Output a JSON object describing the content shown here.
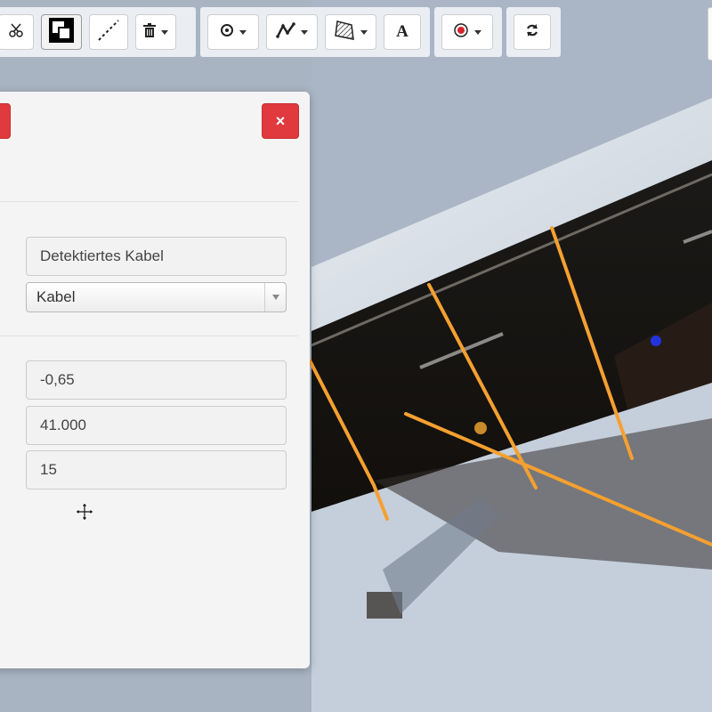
{
  "toolbar": {
    "groups": [
      {
        "name": "edit",
        "buttons": [
          "cut-icon",
          "overlap-squares-icon",
          "dashed-line-icon",
          "trash-icon"
        ]
      },
      {
        "name": "draw",
        "buttons": [
          "point-icon",
          "polyline-icon",
          "polygon-icon",
          "text-icon"
        ]
      },
      {
        "name": "record",
        "buttons": [
          "record-icon"
        ]
      },
      {
        "name": "refresh",
        "buttons": [
          "refresh-icon"
        ]
      }
    ],
    "text_tool_glyph": "A"
  },
  "dialog": {
    "close_label": "×",
    "name_value": "Detektiertes Kabel",
    "type_selected": "Kabel",
    "value_1": "-0,65",
    "value_2": "41.000",
    "value_3": "15"
  },
  "colors": {
    "cable_line": "#f5a030",
    "close_button": "#e0393e",
    "record_dot": "#d9232a",
    "marker_dot": "#2233dd"
  }
}
